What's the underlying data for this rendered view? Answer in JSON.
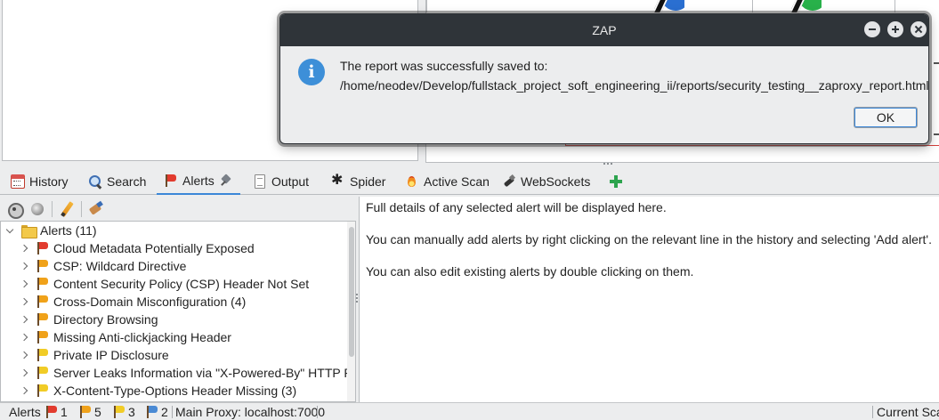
{
  "dialog": {
    "title": "ZAP",
    "message_line1": "The report was successfully saved to:",
    "message_line2": "/home/neodev/Develop/fullstack_project_soft_engineering_ii/reports/security_testing__zaproxy_report.html",
    "ok_label": "OK",
    "icon": "info-icon"
  },
  "tabs": [
    {
      "label": "History",
      "icon": "history-icon"
    },
    {
      "label": "Search",
      "icon": "search-icon"
    },
    {
      "label": "Alerts",
      "icon": "alert-flag-icon",
      "active": true
    },
    {
      "label": "Output",
      "icon": "output-icon"
    },
    {
      "label": "Spider",
      "icon": "spider-icon"
    },
    {
      "label": "Active Scan",
      "icon": "active-scan-icon"
    },
    {
      "label": "WebSockets",
      "icon": "websockets-icon"
    }
  ],
  "alerts_tree": {
    "root_label": "Alerts (11)",
    "items": [
      {
        "label": "Cloud Metadata Potentially Exposed",
        "risk": "high"
      },
      {
        "label": "CSP: Wildcard Directive",
        "risk": "medium"
      },
      {
        "label": "Content Security Policy (CSP) Header Not Set",
        "risk": "medium"
      },
      {
        "label": "Cross-Domain Misconfiguration (4)",
        "risk": "medium"
      },
      {
        "label": "Directory Browsing",
        "risk": "medium"
      },
      {
        "label": "Missing Anti-clickjacking Header",
        "risk": "medium"
      },
      {
        "label": "Private IP Disclosure",
        "risk": "low"
      },
      {
        "label": "Server Leaks Information via \"X-Powered-By\" HTTP Resp",
        "risk": "low"
      },
      {
        "label": "X-Content-Type-Options Header Missing (3)",
        "risk": "low"
      }
    ]
  },
  "details": {
    "line1": "Full details of any selected alert will be displayed here.",
    "line2": "You can manually add alerts by right clicking on the relevant line in the history and selecting 'Add alert'.",
    "line3": "You can also edit existing alerts by double clicking on them."
  },
  "statusbar": {
    "alerts_label": "Alerts",
    "high_count": "1",
    "medium_count": "5",
    "low_count": "3",
    "info_count": "2",
    "proxy": "Main Proxy: localhost:7000",
    "current_scans": "Current Sca"
  },
  "colors": {
    "high": "#e23b2e",
    "medium": "#f0a21a",
    "low": "#f1cc26",
    "info": "#4a8ad4",
    "dialog_titlebar": "#2f3439",
    "info_icon": "#3d8fd8"
  }
}
